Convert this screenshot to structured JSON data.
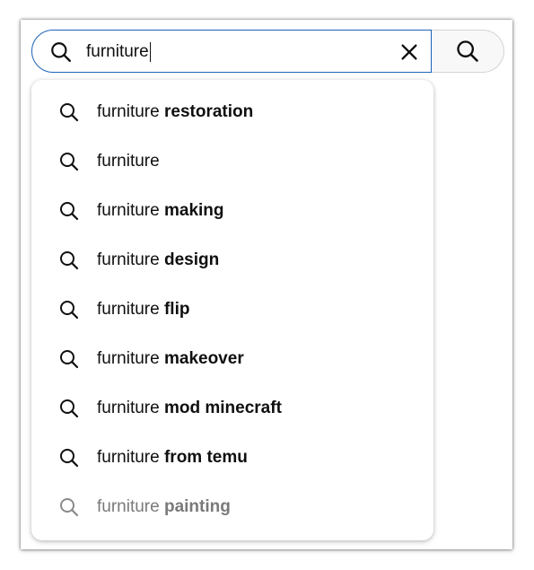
{
  "search": {
    "query": "furniture"
  },
  "suggestions": [
    {
      "prefix": "furniture",
      "suffix": " restoration"
    },
    {
      "prefix": "furniture",
      "suffix": ""
    },
    {
      "prefix": "furniture",
      "suffix": " making"
    },
    {
      "prefix": "furniture",
      "suffix": " design"
    },
    {
      "prefix": "furniture",
      "suffix": " flip"
    },
    {
      "prefix": "furniture",
      "suffix": " makeover"
    },
    {
      "prefix": "furniture",
      "suffix": " mod minecraft"
    },
    {
      "prefix": "furniture",
      "suffix": " from temu"
    },
    {
      "prefix": "furniture",
      "suffix": " painting"
    }
  ],
  "icons": {
    "search": "search-icon",
    "clear": "close-icon"
  },
  "colors": {
    "focus_border": "#1c62b9",
    "text": "#0f0f0f",
    "faded_text": "#7a7a7a",
    "search_button_bg": "#f8f8f8"
  }
}
